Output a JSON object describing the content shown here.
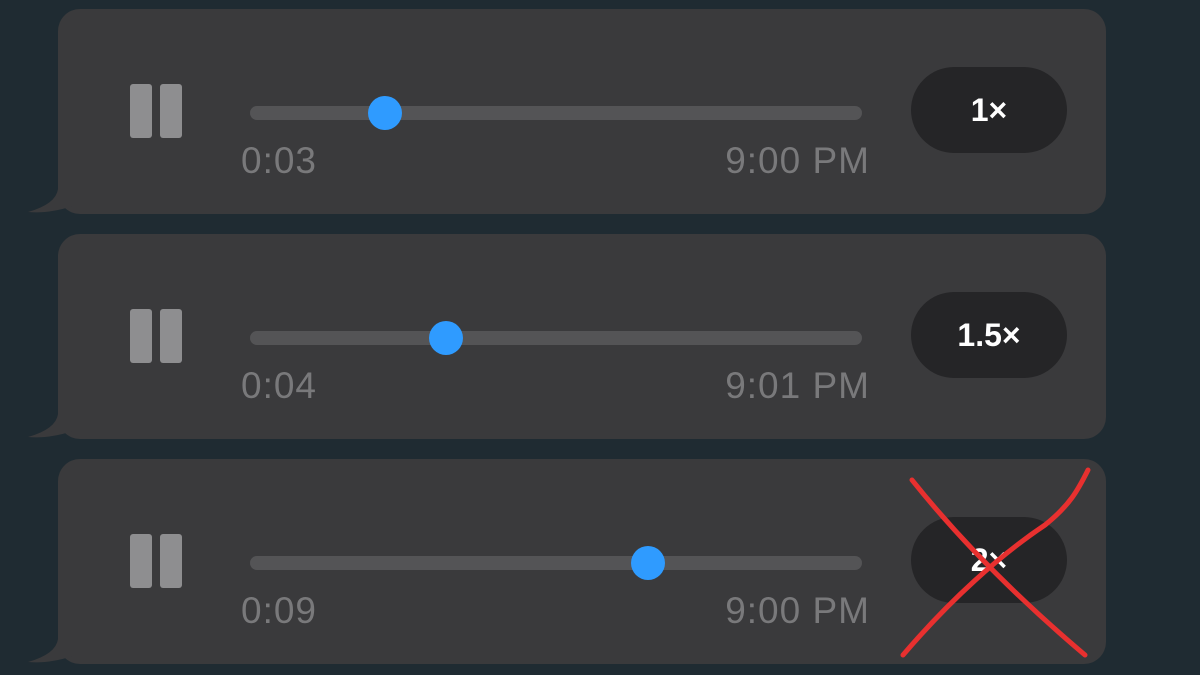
{
  "messages": [
    {
      "elapsed": "0:03",
      "sent_time": "9:00 PM",
      "speed_label": "1×",
      "progress": 0.22
    },
    {
      "elapsed": "0:04",
      "sent_time": "9:01 PM",
      "speed_label": "1.5×",
      "progress": 0.32
    },
    {
      "elapsed": "0:09",
      "sent_time": "9:00 PM",
      "speed_label": "2×",
      "progress": 0.65
    }
  ],
  "colors": {
    "background": "#1f2b32",
    "bubble": "#3a3a3c",
    "accent": "#2f9bff",
    "strike": "#e8302f"
  },
  "icons": {
    "play_state": "pause-icon",
    "annotation": "red-cross-mark"
  }
}
